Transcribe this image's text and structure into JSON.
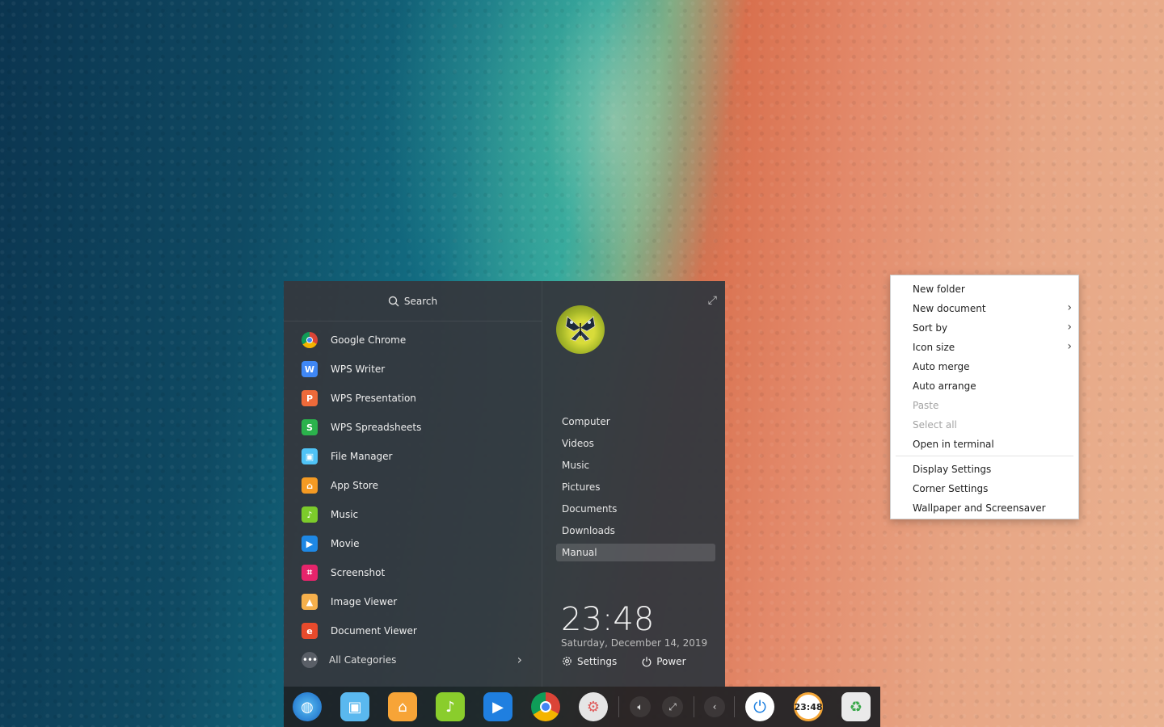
{
  "launcher": {
    "search_label": "Search",
    "apps": [
      {
        "label": "Google Chrome",
        "icon": "chrome-icon",
        "color": "#ffffff"
      },
      {
        "label": "WPS Writer",
        "icon": "wps-writer-icon",
        "color": "#3f87f5"
      },
      {
        "label": "WPS Presentation",
        "icon": "wps-presentation-icon",
        "color": "#ee6a3a"
      },
      {
        "label": "WPS Spreadsheets",
        "icon": "wps-spreadsheets-icon",
        "color": "#2bb24c"
      },
      {
        "label": "File Manager",
        "icon": "file-manager-icon",
        "color": "#4fc3f7"
      },
      {
        "label": "App Store",
        "icon": "app-store-icon",
        "color": "#f59a23"
      },
      {
        "label": "Music",
        "icon": "music-icon",
        "color": "#7ccb2b"
      },
      {
        "label": "Movie",
        "icon": "movie-icon",
        "color": "#1e88e5"
      },
      {
        "label": "Screenshot",
        "icon": "screenshot-icon",
        "color": "#e6246b"
      },
      {
        "label": "Image Viewer",
        "icon": "image-viewer-icon",
        "color": "#f6b04c"
      },
      {
        "label": "Document Viewer",
        "icon": "document-viewer-icon",
        "color": "#e84a2c"
      }
    ],
    "all_categories_label": "All Categories",
    "places": [
      "Computer",
      "Videos",
      "Music",
      "Pictures",
      "Documents",
      "Downloads",
      "Manual"
    ],
    "active_place": "Manual",
    "time": "23:48",
    "date": "Saturday, December 14, 2019",
    "settings_label": "Settings",
    "power_label": "Power"
  },
  "context_menu": {
    "items": [
      {
        "label": "New folder",
        "enabled": true,
        "submenu": false
      },
      {
        "label": "New document",
        "enabled": true,
        "submenu": true
      },
      {
        "label": "Sort by",
        "enabled": true,
        "submenu": true
      },
      {
        "label": "Icon size",
        "enabled": true,
        "submenu": true
      },
      {
        "label": "Auto merge",
        "enabled": true,
        "submenu": false
      },
      {
        "label": "Auto arrange",
        "enabled": true,
        "submenu": false
      },
      {
        "label": "Paste",
        "enabled": false,
        "submenu": false
      },
      {
        "label": "Select all",
        "enabled": false,
        "submenu": false
      },
      {
        "label": "Open in terminal",
        "enabled": true,
        "submenu": false
      },
      {
        "label": "Display Settings",
        "enabled": true,
        "submenu": false
      },
      {
        "label": "Corner Settings",
        "enabled": true,
        "submenu": false
      },
      {
        "label": "Wallpaper and Screensaver",
        "enabled": true,
        "submenu": false
      }
    ]
  },
  "dock": {
    "apps": [
      "launcher-icon",
      "file-manager-icon",
      "app-store-icon",
      "music-icon",
      "movie-icon",
      "chrome-icon",
      "control-center-icon"
    ],
    "tray": [
      "volume-icon",
      "network-icon",
      "collapse-tray-icon"
    ],
    "clock_text": "23:48"
  }
}
